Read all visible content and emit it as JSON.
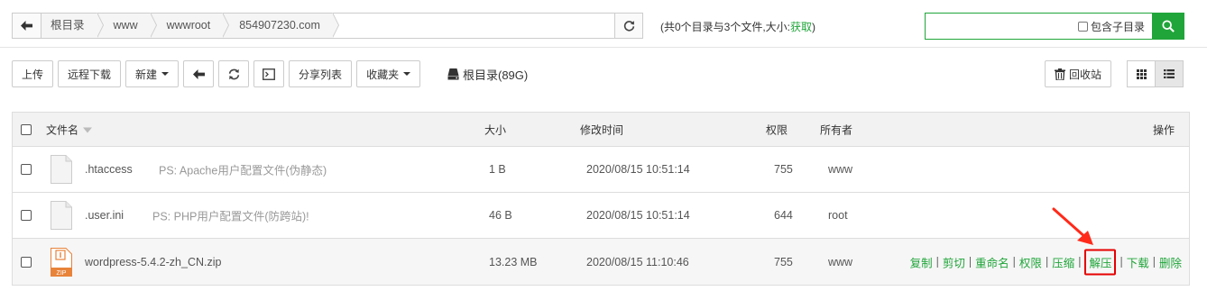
{
  "breadcrumb": [
    "根目录",
    "www",
    "wwwroot",
    "854907230.com"
  ],
  "summary": {
    "text": "(共0个目录与3个文件,大小:",
    "link": "获取",
    "close": ")"
  },
  "search": {
    "value": "",
    "placeholder": "",
    "subdir_label": "包含子目录"
  },
  "toolbar": {
    "upload": "上传",
    "remote_download": "远程下载",
    "new": "新建",
    "share_list": "分享列表",
    "favorites": "收藏夹",
    "disk": "根目录(89G)",
    "recycle": "回收站"
  },
  "table": {
    "headers": {
      "name": "文件名",
      "size": "大小",
      "mtime": "修改时间",
      "perm": "权限",
      "owner": "所有者",
      "ops": "操作"
    },
    "rows": [
      {
        "name": ".htaccess",
        "ps": "PS: Apache用户配置文件(伪静态)",
        "size": "1 B",
        "mtime": "2020/08/15 10:51:14",
        "perm": "755",
        "owner": "www",
        "icon": "file-icon"
      },
      {
        "name": ".user.ini",
        "ps": "PS: PHP用户配置文件(防跨站)!",
        "size": "46 B",
        "mtime": "2020/08/15 10:51:14",
        "perm": "644",
        "owner": "root",
        "icon": "file-icon"
      },
      {
        "name": "wordpress-5.4.2-zh_CN.zip",
        "ps": "",
        "size": "13.23 MB",
        "mtime": "2020/08/15 11:10:46",
        "perm": "755",
        "owner": "www",
        "icon": "zip-icon",
        "zip_label": "ZIP"
      }
    ],
    "actions": [
      "复制",
      "剪切",
      "重命名",
      "权限",
      "压缩",
      "解压",
      "下载",
      "删除"
    ]
  },
  "colors": {
    "accent": "#20a53a",
    "highlight": "#e60000"
  }
}
